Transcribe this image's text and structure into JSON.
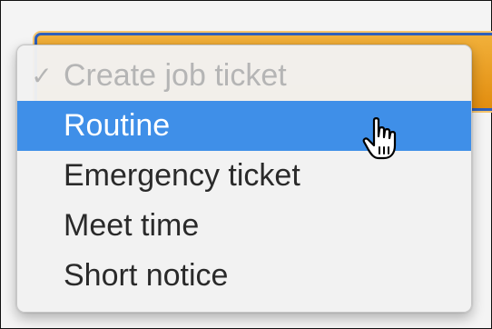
{
  "menu": {
    "header": {
      "label": "Create job ticket",
      "checkmark": "✓",
      "checked": true,
      "enabled": false
    },
    "items": [
      {
        "label": "Routine",
        "highlighted": true
      },
      {
        "label": "Emergency ticket",
        "highlighted": false
      },
      {
        "label": "Meet time",
        "highlighted": false
      },
      {
        "label": "Short notice",
        "highlighted": false
      }
    ]
  },
  "cursor": {
    "icon": "pointing-hand-cursor-icon"
  },
  "colors": {
    "highlight": "#3f8fe8",
    "button_orange": "#e8991f",
    "focus_ring": "#2e5fba",
    "disabled_text": "#b5b5b5"
  }
}
